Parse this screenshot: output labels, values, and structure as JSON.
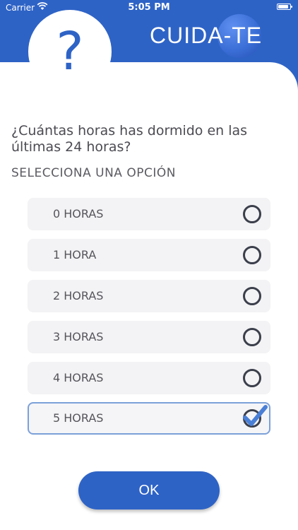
{
  "status_bar": {
    "carrier": "Carrier",
    "time": "5:05 PM"
  },
  "header": {
    "help_symbol": "?",
    "logo_text": "CUIDA-TE"
  },
  "question": "¿Cuántas horas has dormido en las últimas 24 horas?",
  "subtitle": "SELECCIONA UNA OPCIÓN",
  "options": [
    {
      "label": "0 HORAS",
      "selected": false
    },
    {
      "label": "1 HORA",
      "selected": false
    },
    {
      "label": "2 HORAS",
      "selected": false
    },
    {
      "label": "3 HORAS",
      "selected": false
    },
    {
      "label": "4 HORAS",
      "selected": false
    },
    {
      "label": "5 HORAS",
      "selected": true
    }
  ],
  "ok_label": "OK",
  "colors": {
    "primary": "#2e63c6",
    "selected_border": "#7ca0d9",
    "radio": "#3b3f4b",
    "check": "#4a7fd6"
  }
}
